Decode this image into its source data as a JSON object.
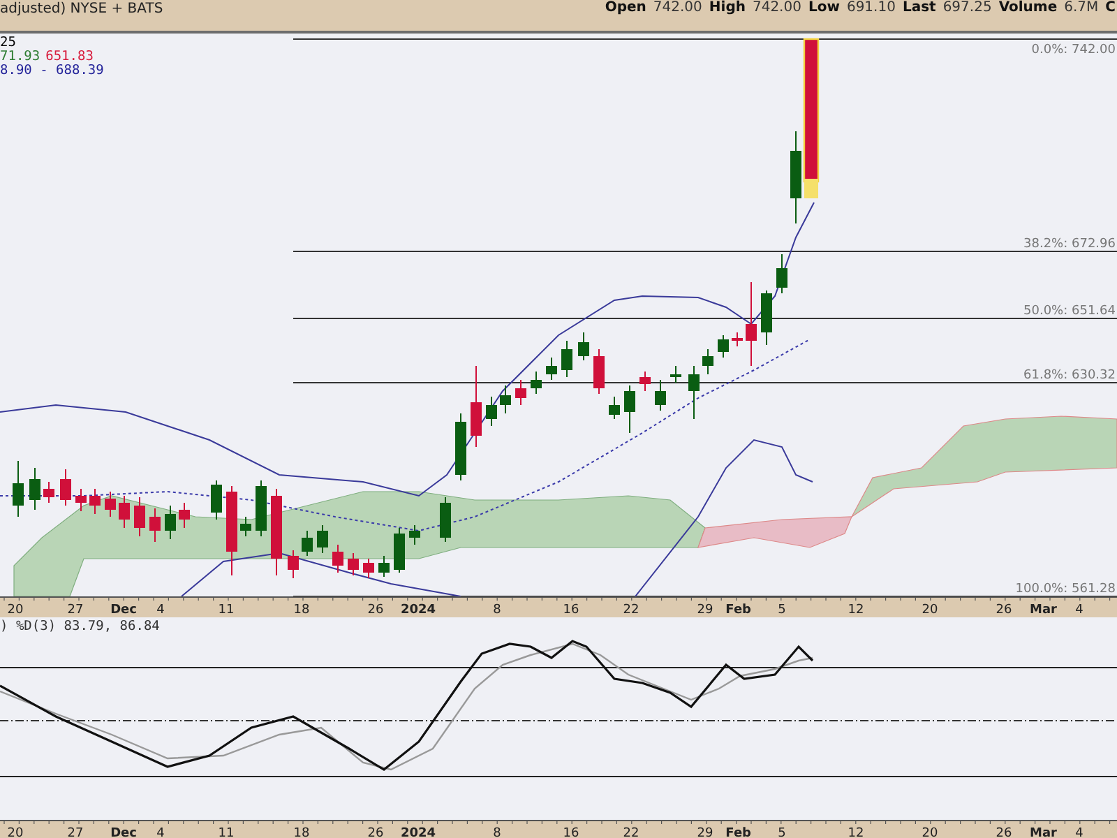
{
  "header": {
    "title": "adjusted) NYSE + BATS",
    "quote": [
      {
        "label": "Open",
        "value": "742.00"
      },
      {
        "label": "High",
        "value": "742.00"
      },
      {
        "label": "Low",
        "value": "691.10"
      },
      {
        "label": "Last",
        "value": "697.25"
      },
      {
        "label": "Volume",
        "value": "6.7M"
      }
    ],
    "cut_label": "C"
  },
  "legend": [
    {
      "parts": [
        {
          "text": "25",
          "color": "#000000"
        }
      ]
    },
    {
      "parts": [
        {
          "text": "71.93",
          "color": "#2e7d32"
        },
        {
          "text": "651.83",
          "color": "#d81b3c"
        }
      ]
    },
    {
      "parts": [
        {
          "text": "8.90 - 688.39",
          "color": "#23239a"
        }
      ]
    }
  ],
  "fib_levels": [
    {
      "label": "0.0%: 742.00"
    },
    {
      "label": "38.2%: 672.96"
    },
    {
      "label": "50.0%: 651.64"
    },
    {
      "label": "61.8%: 630.32"
    },
    {
      "label": "100.0%: 561.28"
    }
  ],
  "date_axis": [
    {
      "text": "20",
      "bold": false
    },
    {
      "text": "27",
      "bold": false
    },
    {
      "text": "Dec",
      "bold": true
    },
    {
      "text": "4",
      "bold": false
    },
    {
      "text": "11",
      "bold": false
    },
    {
      "text": "18",
      "bold": false
    },
    {
      "text": "26",
      "bold": false
    },
    {
      "text": "2024",
      "bold": true
    },
    {
      "text": "8",
      "bold": false
    },
    {
      "text": "16",
      "bold": false
    },
    {
      "text": "22",
      "bold": false
    },
    {
      "text": "29",
      "bold": false
    },
    {
      "text": "Feb",
      "bold": true
    },
    {
      "text": "5",
      "bold": false
    },
    {
      "text": "12",
      "bold": false
    },
    {
      "text": "20",
      "bold": false
    },
    {
      "text": "26",
      "bold": false
    },
    {
      "text": "Mar",
      "bold": true
    },
    {
      "text": "4",
      "bold": false
    }
  ],
  "stoch_legend": ") %D(3) 83.79, 86.84",
  "bottom_axis": [
    {
      "text": "20",
      "bold": false
    },
    {
      "text": "27",
      "bold": false
    },
    {
      "text": "Dec",
      "bold": true
    },
    {
      "text": "4",
      "bold": false
    },
    {
      "text": "11",
      "bold": false
    },
    {
      "text": "18",
      "bold": false
    },
    {
      "text": "26",
      "bold": false
    },
    {
      "text": "2024",
      "bold": true
    },
    {
      "text": "8",
      "bold": false
    },
    {
      "text": "16",
      "bold": false
    },
    {
      "text": "22",
      "bold": false
    },
    {
      "text": "29",
      "bold": false
    },
    {
      "text": "Feb",
      "bold": true
    },
    {
      "text": "5",
      "bold": false
    },
    {
      "text": "12",
      "bold": false
    },
    {
      "text": "20",
      "bold": false
    },
    {
      "text": "26",
      "bold": false
    },
    {
      "text": "Mar",
      "bold": true
    },
    {
      "text": "4",
      "bold": false
    }
  ]
}
